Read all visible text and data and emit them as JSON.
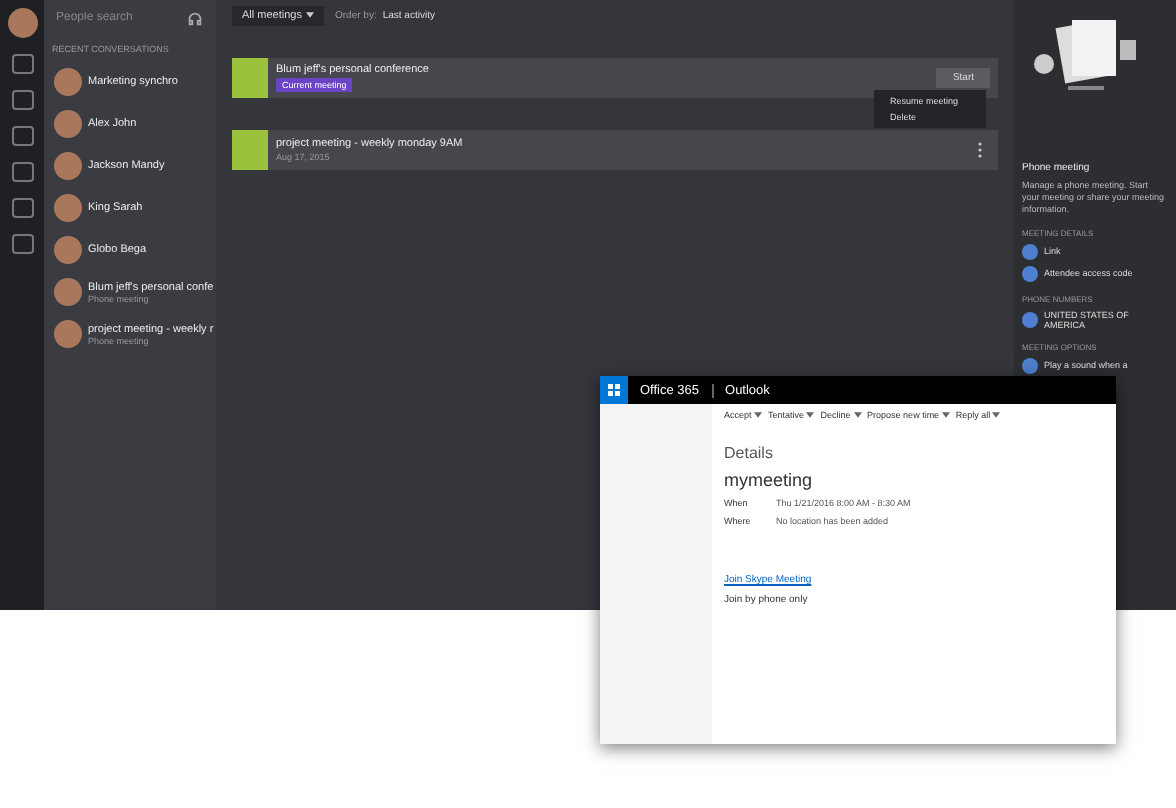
{
  "search": {
    "placeholder": "People search"
  },
  "conversations_heading": "RECENT CONVERSATIONS",
  "conversations": [
    {
      "name": "Marketing synchro",
      "selected": false
    },
    {
      "name": "Alex John",
      "selected": false
    },
    {
      "name": "Jackson Mandy",
      "selected": false
    },
    {
      "name": "King Sarah",
      "selected": false
    },
    {
      "name": "Globo Bega",
      "selected": false
    },
    {
      "name": "Blum jeff's personal confe",
      "subtitle": "Phone meeting",
      "selected": false
    },
    {
      "name": "project meeting - weekly r",
      "subtitle": "Phone meeting",
      "selected": false
    }
  ],
  "filter": {
    "value": "All meetings",
    "order_label": "Order by:",
    "order_value": "Last activity"
  },
  "meetings": [
    {
      "title": "Blum jeff's personal conference",
      "badge": "Current meeting",
      "button": "Start"
    },
    {
      "title": "project meeting - weekly monday 9AM",
      "date": "Aug 17, 2015"
    }
  ],
  "context_menu": [
    "Resume meeting",
    "Delete"
  ],
  "details": {
    "title": "Phone meeting",
    "description": "Manage a phone meeting. Start your meeting or share your meeting information.",
    "sections": [
      {
        "heading": "MEETING DETAILS",
        "items": [
          "Link",
          "Attendee access code"
        ]
      },
      {
        "heading": "PHONE NUMBERS",
        "items": [
          "UNITED STATES OF AMERICA"
        ]
      },
      {
        "heading": "MEETING OPTIONS",
        "items": [
          "Play a sound when a"
        ]
      }
    ]
  },
  "outlook": {
    "brand": "Office 365",
    "app": "Outlook",
    "toolbar": [
      "Accept",
      "Tentative",
      "Decline",
      "Propose new time",
      "Reply all"
    ],
    "heading": "Details",
    "subject": "mymeeting",
    "fields": [
      {
        "label": "When",
        "value": "Thu 1/21/2016 8:00 AM - 8:30 AM"
      },
      {
        "label": "Where",
        "value": "No location has been added"
      }
    ],
    "join_label": "Join Skype Meeting",
    "phone_label": "Join by phone only"
  }
}
